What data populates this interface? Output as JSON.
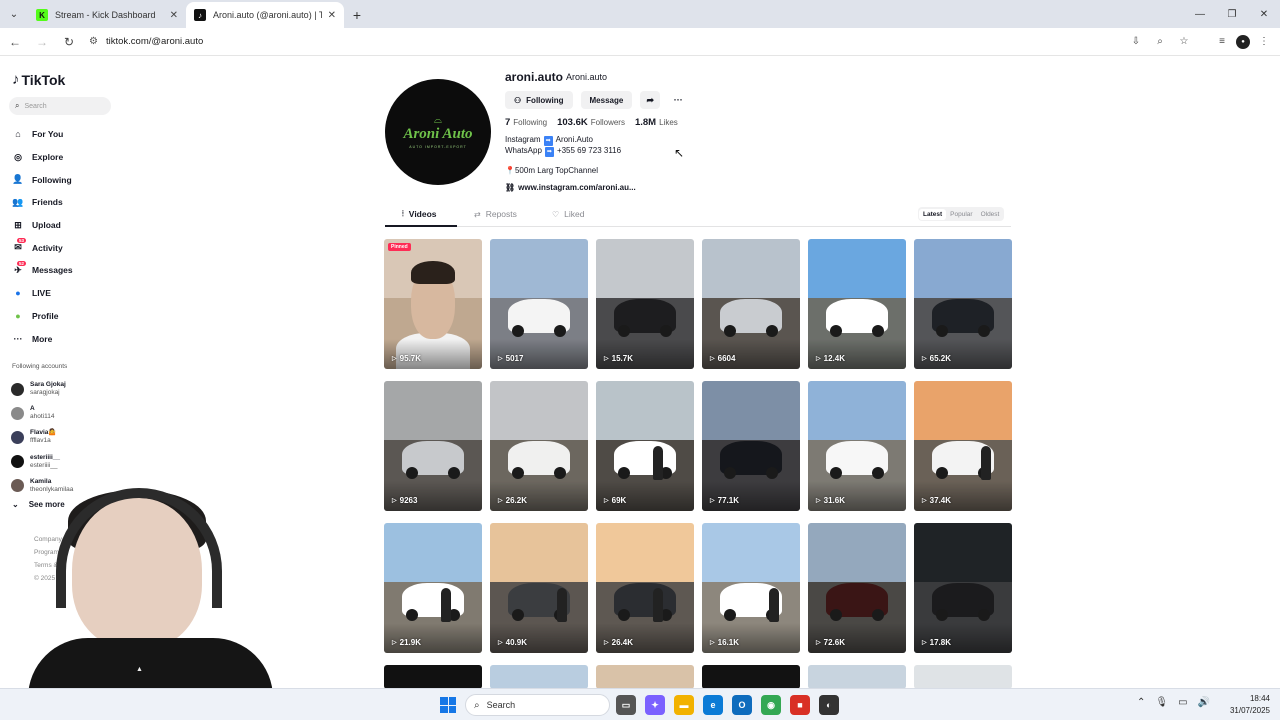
{
  "browser": {
    "tabs": [
      {
        "title": "Stream - Kick Dashboard",
        "favicon": "K",
        "color": "#53fc18",
        "active": false
      },
      {
        "title": "Aroni.auto (@aroni.auto) | TikTok",
        "favicon": "♪",
        "color": "#111111",
        "active": true
      }
    ],
    "url": "tiktok.com/@aroni.auto"
  },
  "sidebar": {
    "logo": "TikTok",
    "search_placeholder": "Search",
    "menu": [
      {
        "label": "For You",
        "icon": "home-icon",
        "glyph": "⌂"
      },
      {
        "label": "Explore",
        "icon": "compass-icon",
        "glyph": "◎"
      },
      {
        "label": "Following",
        "icon": "following-icon",
        "glyph": "👤"
      },
      {
        "label": "Friends",
        "icon": "friends-icon",
        "glyph": "👥"
      },
      {
        "label": "Upload",
        "icon": "upload-icon",
        "glyph": "⊞"
      },
      {
        "label": "Activity",
        "icon": "activity-icon",
        "glyph": "✉",
        "badge": "53"
      },
      {
        "label": "Messages",
        "icon": "messages-icon",
        "glyph": "✈",
        "badge": "52"
      },
      {
        "label": "LIVE",
        "icon": "live-icon",
        "glyph": "●"
      },
      {
        "label": "Profile",
        "icon": "profile-icon",
        "glyph": "●"
      },
      {
        "label": "More",
        "icon": "more-icon",
        "glyph": "···"
      }
    ],
    "following_title": "Following accounts",
    "following_accounts": [
      {
        "name": "Sara Gjokaj",
        "handle": "saragjokaj"
      },
      {
        "name": "A",
        "handle": "ahoti114"
      },
      {
        "name": "Flavia🤷",
        "handle": "ffflav1a"
      },
      {
        "name": "esteriiii__",
        "handle": "esteriiii__"
      },
      {
        "name": "Kamila",
        "handle": "theonlykamilaa"
      }
    ],
    "see_more": "See more",
    "footer": [
      "Company",
      "Program",
      "Terms & P",
      "© 2025 Tik"
    ]
  },
  "profile": {
    "username": "aroni.auto",
    "nickname": "Aroni.auto",
    "avatar_brand": "Aroni Auto",
    "avatar_sub": "AUTO IMPORT-EXPORT",
    "following_btn": "Following",
    "message_btn": "Message",
    "stats": [
      {
        "value": "7",
        "label": "Following"
      },
      {
        "value": "103.6K",
        "label": "Followers"
      },
      {
        "value": "1.8M",
        "label": "Likes"
      }
    ],
    "bio_line1_prefix": "Instagram",
    "bio_line1_value": "Aroni.Auto",
    "bio_line2_prefix": "WhatsApp",
    "bio_line2_value": "+355 69 723 3116",
    "location": "500m Larg TopChannel",
    "link": "www.instagram.com/aroni.au..."
  },
  "content_tabs": [
    {
      "label": "Videos",
      "icon": "grid-icon",
      "active": true
    },
    {
      "label": "Reposts",
      "icon": "repost-icon",
      "active": false
    },
    {
      "label": "Liked",
      "icon": "liked-icon",
      "active": false
    }
  ],
  "sort": [
    "Latest",
    "Popular",
    "Oldest"
  ],
  "videos": [
    {
      "views": "95.7K",
      "pinned": "Pinned",
      "sky": "#d9c7b6",
      "ground": "#bfa890",
      "car": "none"
    },
    {
      "views": "5017",
      "sky": "#9fb8d4",
      "ground": "#7c7f86",
      "car": "#f4f4f4"
    },
    {
      "views": "15.7K",
      "sky": "#c4c8cc",
      "ground": "#4a4a4c",
      "car": "#1d1d1f"
    },
    {
      "views": "6604",
      "sky": "#b8c2cc",
      "ground": "#5a5550",
      "car": "#c9ccd0"
    },
    {
      "views": "12.4K",
      "sky": "#6aa7e0",
      "ground": "#6c6f6a",
      "car": "#ffffff"
    },
    {
      "views": "65.2K",
      "sky": "#88a9d1",
      "ground": "#545558",
      "car": "#1e2126"
    },
    {
      "views": "9263",
      "sky": "#a5a7a8",
      "ground": "#5b5753",
      "car": "#c7c9cc"
    },
    {
      "views": "26.2K",
      "sky": "#c2c4c7",
      "ground": "#6c675f",
      "car": "#f0f0ef"
    },
    {
      "views": "69K",
      "sky": "#b9c3c9",
      "ground": "#4f4b46",
      "car": "#ffffff",
      "person": true
    },
    {
      "views": "77.1K",
      "sky": "#7d8fa6",
      "ground": "#3d3c3f",
      "car": "#15171c"
    },
    {
      "views": "31.6K",
      "sky": "#8fb2d8",
      "ground": "#7d7a73",
      "car": "#f7f7f7"
    },
    {
      "views": "37.4K",
      "sky": "#e9a36a",
      "ground": "#6a6157",
      "car": "#f3f3f3",
      "person": true
    },
    {
      "views": "21.9K",
      "sky": "#9cc0e0",
      "ground": "#807a70",
      "car": "#ffffff",
      "person": true
    },
    {
      "views": "40.9K",
      "sky": "#e7c39a",
      "ground": "#5c5651",
      "car": "#3b3d40",
      "person": true
    },
    {
      "views": "26.4K",
      "sky": "#f0c89a",
      "ground": "#5e5852",
      "car": "#2b2d31",
      "person": true
    },
    {
      "views": "16.1K",
      "sky": "#a9c8e6",
      "ground": "#8d877d",
      "car": "#ffffff",
      "person": true
    },
    {
      "views": "72.6K",
      "sky": "#94a8bd",
      "ground": "#4a4845",
      "car": "#3a1515"
    },
    {
      "views": "17.8K",
      "sky": "#1f2326",
      "ground": "#3a3b3d",
      "car": "#1b1b1d"
    }
  ],
  "taskbar": {
    "search": "Search",
    "time": "18:44",
    "date": "31/07/2025"
  }
}
